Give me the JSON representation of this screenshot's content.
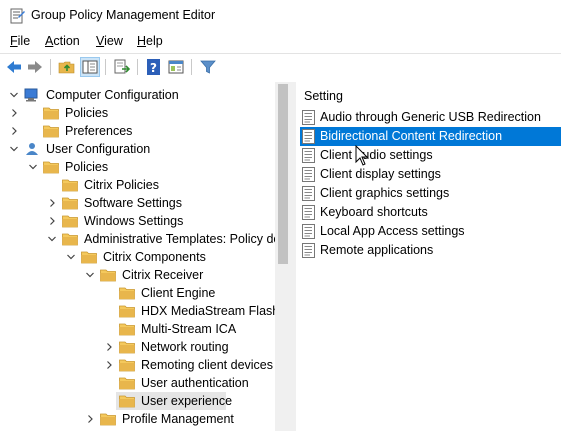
{
  "window": {
    "title": "Group Policy Management Editor"
  },
  "menu": [
    {
      "label": "File",
      "key": "F",
      "rest": "ile"
    },
    {
      "label": "Action",
      "key": "A",
      "rest": "ction"
    },
    {
      "label": "View",
      "key": "V",
      "rest": "iew"
    },
    {
      "label": "Help",
      "key": "H",
      "rest": "elp"
    }
  ],
  "toolbar": [
    "back-arrow-icon",
    "forward-arrow-icon",
    "up-folder-icon",
    "show-hide-tree-icon",
    "export-list-icon",
    "help-icon",
    "properties-icon",
    "filter-icon"
  ],
  "tree": [
    {
      "label": "Computer Configuration",
      "expander": "expanded",
      "icon": "computer"
    },
    {
      "label": "Policies",
      "expander": "collapsed",
      "icon": "folder"
    },
    {
      "label": "Preferences",
      "expander": "collapsed",
      "icon": "folder"
    },
    {
      "label": "User Configuration",
      "expander": "expanded",
      "icon": "user"
    },
    {
      "label": "Policies",
      "expander": "expanded",
      "icon": "folder"
    },
    {
      "label": "Citrix Policies",
      "expander": "none",
      "icon": "folder"
    },
    {
      "label": "Software Settings",
      "expander": "collapsed",
      "icon": "folder"
    },
    {
      "label": "Windows Settings",
      "expander": "collapsed",
      "icon": "folder"
    },
    {
      "label": "Administrative Templates: Policy def",
      "expander": "expanded",
      "icon": "folder"
    },
    {
      "label": "Citrix Components",
      "expander": "expanded",
      "icon": "folder"
    },
    {
      "label": "Citrix Receiver",
      "expander": "expanded",
      "icon": "folder"
    },
    {
      "label": "Client Engine",
      "expander": "none",
      "icon": "folder"
    },
    {
      "label": "HDX MediaStream Flash F",
      "expander": "none",
      "icon": "folder"
    },
    {
      "label": "Multi-Stream ICA",
      "expander": "none",
      "icon": "folder"
    },
    {
      "label": "Network routing",
      "expander": "collapsed",
      "icon": "folder"
    },
    {
      "label": "Remoting client devices",
      "expander": "collapsed",
      "icon": "folder"
    },
    {
      "label": "User authentication",
      "expander": "none",
      "icon": "folder"
    },
    {
      "label": "User experience",
      "expander": "none",
      "icon": "folder",
      "selected": true
    },
    {
      "label": "Profile Management",
      "expander": "collapsed",
      "icon": "folder"
    }
  ],
  "settings": {
    "header": "Setting",
    "items": [
      {
        "label": "Audio through Generic USB Redirection"
      },
      {
        "label": "Bidirectional Content Redirection",
        "selected": true
      },
      {
        "label": "Client audio settings"
      },
      {
        "label": "Client display settings"
      },
      {
        "label": "Client graphics settings"
      },
      {
        "label": "Keyboard shortcuts"
      },
      {
        "label": "Local App Access settings"
      },
      {
        "label": "Remote applications"
      }
    ]
  },
  "colors": {
    "selection": "#0078d7",
    "tree_selection": "#e5e5e5",
    "folder": "#e8b64c"
  }
}
